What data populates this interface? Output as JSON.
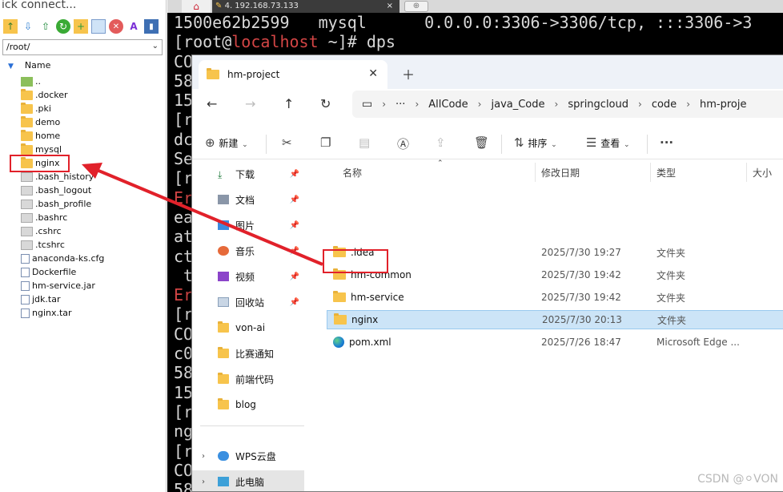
{
  "sftp": {
    "quick_connect": "ick connect...",
    "path": "/root/",
    "column": "Name",
    "items": [
      {
        "name": "..",
        "icon": "up-folder-icon"
      },
      {
        "name": ".docker",
        "icon": "folder-icon"
      },
      {
        "name": ".pki",
        "icon": "folder-icon"
      },
      {
        "name": "demo",
        "icon": "folder-icon"
      },
      {
        "name": "home",
        "icon": "folder-icon"
      },
      {
        "name": "mysql",
        "icon": "folder-icon"
      },
      {
        "name": "nginx",
        "icon": "folder-icon"
      },
      {
        "name": ".bash_history",
        "icon": "hidden-file-icon"
      },
      {
        "name": ".bash_logout",
        "icon": "hidden-file-icon"
      },
      {
        "name": ".bash_profile",
        "icon": "hidden-file-icon"
      },
      {
        "name": ".bashrc",
        "icon": "hidden-file-icon"
      },
      {
        "name": ".cshrc",
        "icon": "hidden-file-icon"
      },
      {
        "name": ".tcshrc",
        "icon": "hidden-file-icon"
      },
      {
        "name": "anaconda-ks.cfg",
        "icon": "file-icon"
      },
      {
        "name": "Dockerfile",
        "icon": "file-icon"
      },
      {
        "name": "hm-service.jar",
        "icon": "file-icon"
      },
      {
        "name": "jdk.tar",
        "icon": "file-icon"
      },
      {
        "name": "nginx.tar",
        "icon": "file-icon"
      }
    ]
  },
  "terminal": {
    "tab_label": "4. 192.168.73.133",
    "lines": [
      "1500e62b2599   mysql      0.0.0.0:3306->3306/tcp, :::3306->3",
      "[root@localhost ~]# dps",
      "CO",
      "58",
      "15",
      "[r",
      "dc",
      "Se",
      "[r",
      "Er",
      "ea",
      "at",
      "ct",
      " t",
      "Er",
      "[r",
      "CO",
      "c0",
      "58",
      "15",
      "[r",
      "ng",
      "[r",
      "CO",
      "58"
    ]
  },
  "explorer": {
    "tab_title": "hm-project",
    "breadcrumb": [
      "AllCode",
      "java_Code",
      "springcloud",
      "code",
      "hm-proje"
    ],
    "toolbar": {
      "new": "新建",
      "sort": "排序",
      "view": "查看",
      "more": "···"
    },
    "nav": [
      {
        "label": "下载",
        "icon": "download-icon"
      },
      {
        "label": "文档",
        "icon": "document-icon"
      },
      {
        "label": "图片",
        "icon": "picture-icon"
      },
      {
        "label": "音乐",
        "icon": "music-icon"
      },
      {
        "label": "视频",
        "icon": "video-icon"
      },
      {
        "label": "回收站",
        "icon": "recycle-bin-icon"
      },
      {
        "label": "von-ai",
        "icon": "folder-icon"
      },
      {
        "label": "比赛通知",
        "icon": "folder-icon"
      },
      {
        "label": "前端代码",
        "icon": "folder-icon"
      },
      {
        "label": "blog",
        "icon": "folder-icon"
      },
      {
        "label": "WPS云盘",
        "icon": "cloud-icon"
      },
      {
        "label": "此电脑",
        "icon": "computer-icon"
      }
    ],
    "columns": {
      "name": "名称",
      "date": "修改日期",
      "type": "类型",
      "size": "大小"
    },
    "files": [
      {
        "name": ".idea",
        "date": "2025/7/30 19:27",
        "type": "文件夹"
      },
      {
        "name": "hm-common",
        "date": "2025/7/30 19:42",
        "type": "文件夹"
      },
      {
        "name": "hm-service",
        "date": "2025/7/30 19:42",
        "type": "文件夹"
      },
      {
        "name": "nginx",
        "date": "2025/7/30 20:13",
        "type": "文件夹"
      },
      {
        "name": "pom.xml",
        "date": "2025/7/26 18:47",
        "type": "Microsoft Edge ..."
      }
    ]
  },
  "watermark": "CSDN @⚪VON",
  "colors": {
    "highlight": "#e1212a",
    "folder": "#f7c44c",
    "selection": "#cce4f7"
  }
}
